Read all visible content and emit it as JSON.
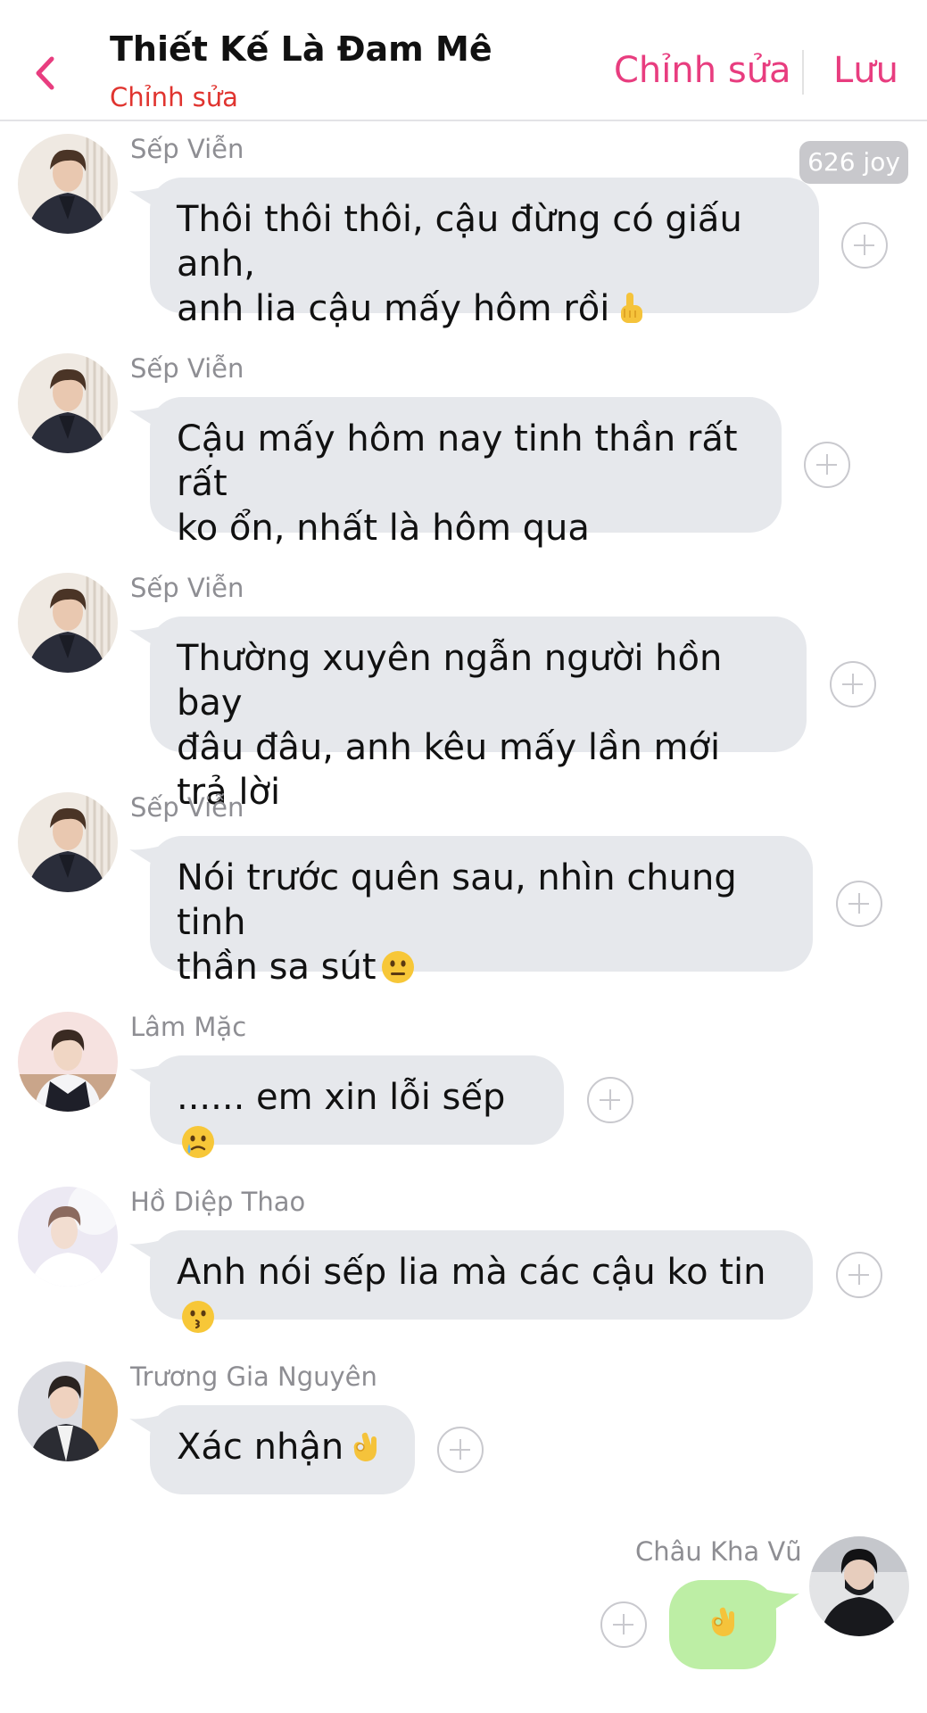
{
  "header": {
    "title": "Thiết Kế Là Đam Mê",
    "subtitle": "Chỉnh sửa",
    "edit_label": "Chỉnh sửa",
    "save_label": "Lưu"
  },
  "joy_badge": "626 joy",
  "messages": [
    {
      "sender": "Sếp Viễn",
      "lines": [
        "Thôi thôi thôi, cậu đừng có giấu anh,",
        "anh lia cậu mấy hôm rồi"
      ],
      "emoji": "pointing-up-hand"
    },
    {
      "sender": "Sếp Viễn",
      "lines": [
        "Cậu mấy hôm nay tinh thần rất rất",
        "ko ổn, nhất là hôm qua"
      ]
    },
    {
      "sender": "Sếp Viễn",
      "lines": [
        "Thường xuyên ngẫn người hồn bay",
        "đâu đâu, anh kêu mấy lần mới trả lời"
      ]
    },
    {
      "sender": "Sếp Viễn",
      "lines": [
        "Nói trước quên sau, nhìn chung tinh",
        "thần sa sút"
      ],
      "emoji": "neutral-face"
    },
    {
      "sender": "Lâm Mặc",
      "lines": [
        "...... em xin lỗi sếp"
      ],
      "emoji": "tearful-smile-face"
    },
    {
      "sender": "Hồ Diệp Thao",
      "lines": [
        "Anh nói sếp lia mà các cậu ko tin"
      ],
      "emoji": "kissing-face"
    },
    {
      "sender": "Trương Gia Nguyên",
      "lines": [
        "Xác nhận"
      ],
      "emoji": "ok-hand"
    },
    {
      "sender": "Châu Kha Vũ",
      "lines": [
        ""
      ],
      "emoji": "ok-hand",
      "mine": true
    }
  ],
  "colors": {
    "accent": "#e83d7f",
    "subtitle": "#e0342f",
    "incoming_bubble": "#e6e8ec",
    "outgoing_bubble": "#bdeea5"
  }
}
